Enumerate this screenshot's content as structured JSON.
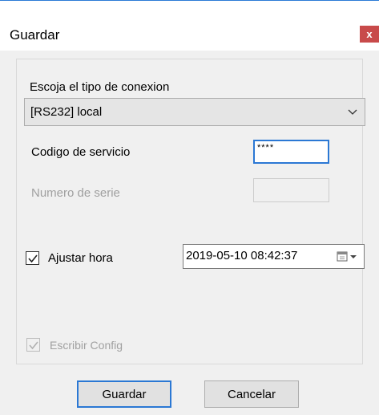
{
  "window": {
    "title": "Guardar",
    "close_label": "x"
  },
  "connection": {
    "label": "Escoja el tipo de conexion",
    "selected": "[RS232] local"
  },
  "service_code": {
    "label": "Codigo de servicio",
    "value": "****"
  },
  "serial_number": {
    "label": "Numero de serie",
    "value": ""
  },
  "adjust_time": {
    "label": "Ajustar hora",
    "checked": true,
    "datetime": "2019-05-10 08:42:37"
  },
  "write_config": {
    "label": "Escribir Config",
    "checked": true,
    "disabled": true
  },
  "buttons": {
    "save": "Guardar",
    "cancel": "Cancelar"
  },
  "colors": {
    "accent": "#2b78d4",
    "close": "#c84a4a"
  }
}
